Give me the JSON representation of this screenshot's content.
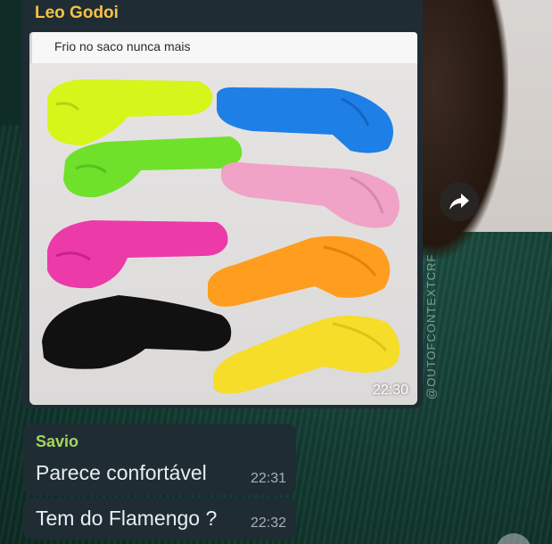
{
  "message": {
    "sender": "Leo Godoi",
    "caption": "Frio no saco nunca mais",
    "time": "22:30"
  },
  "watermark": "@OUTOFCONTEXTCRF",
  "reply": {
    "sender": "Savio",
    "text": "Parece confortável",
    "time": "22:31"
  },
  "second": {
    "text": "Tem do Flamengo ?",
    "time": "22:32"
  },
  "colors": {
    "bubble": "#1f2c34",
    "sender_leo": "#f5c243",
    "sender_savio": "#a5d65e",
    "items": [
      "#d6f51a",
      "#1e7fe6",
      "#6fe12a",
      "#f0a3c6",
      "#ec3aa9",
      "#ff9d1f",
      "#111111",
      "#f5dd2a"
    ]
  },
  "icons": {
    "forward": "forward-arrow-icon"
  }
}
